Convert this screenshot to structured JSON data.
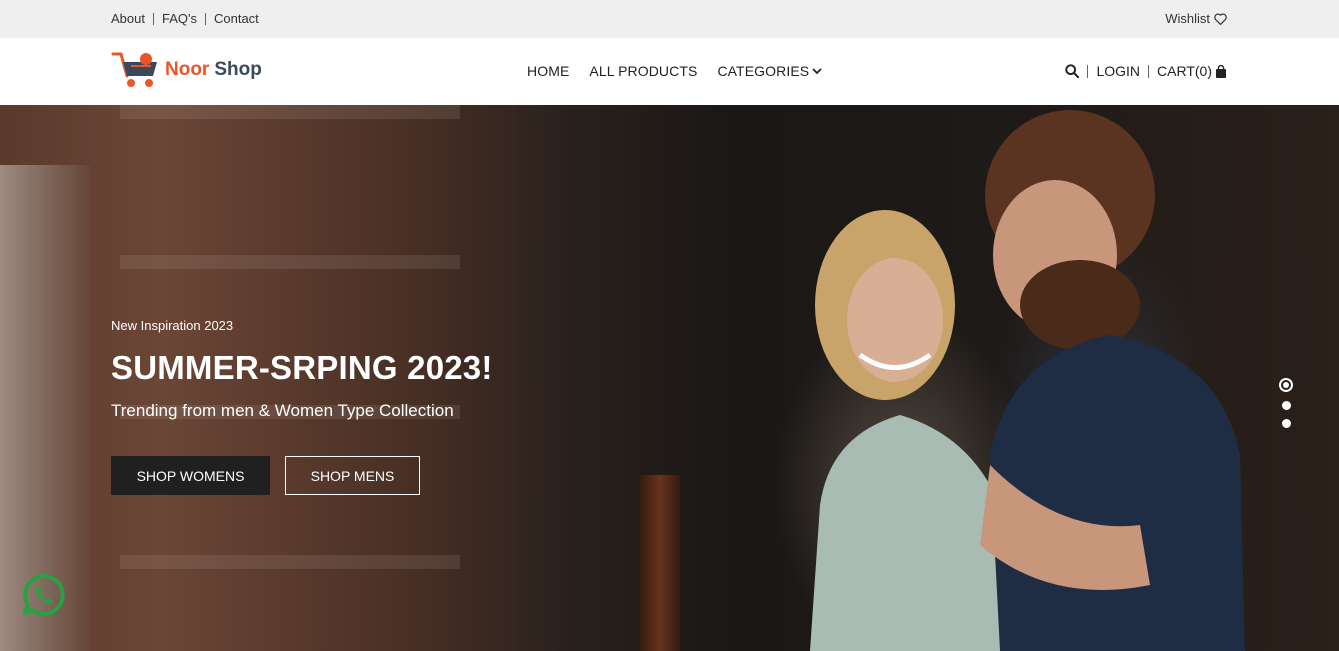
{
  "topbar": {
    "links": [
      "About",
      "FAQ's",
      "Contact"
    ],
    "wishlist": "Wishlist"
  },
  "header": {
    "logo_part1": "Noor",
    "logo_part2": "Shop",
    "nav": [
      "HOME",
      "ALL PRODUCTS",
      "CATEGORIES"
    ],
    "login": "LOGIN",
    "cart": "CART(0)"
  },
  "hero": {
    "eyebrow": "New Inspiration 2023",
    "headline": "SUMMER-SRPING 2023!",
    "subheadline": "Trending from men & Women Type Collection",
    "button_women": "SHOP WOMENS",
    "button_men": "SHOP MENS",
    "slide_count": 3,
    "active_slide": 1
  },
  "colors": {
    "brand_orange": "#e8562a",
    "brand_dark": "#3a4a5c",
    "whatsapp": "#25a244"
  },
  "icons": [
    "heart-icon",
    "search-icon",
    "cart-bag-icon",
    "chevron-down-icon",
    "whatsapp-icon"
  ]
}
